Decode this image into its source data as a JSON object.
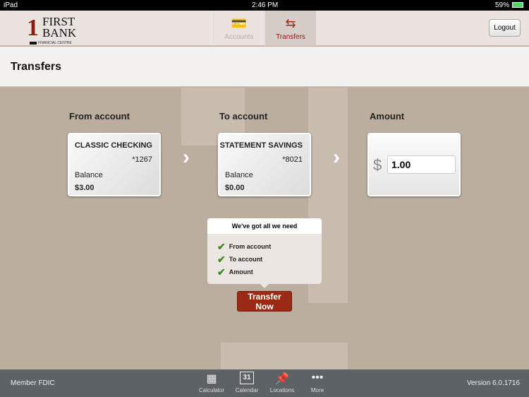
{
  "status": {
    "device": "iPad",
    "time": "2:46 PM",
    "battery": "59%"
  },
  "header": {
    "logo": {
      "one": "1",
      "line1": "FIRST",
      "line2": "BANK",
      "sub": "FINANCIAL CENTRE"
    },
    "tabs": [
      {
        "label": "Accounts",
        "icon": "credit-card-icon",
        "active": false
      },
      {
        "label": "Transfers",
        "icon": "transfer-arrows-icon",
        "active": true
      }
    ],
    "logout": "Logout"
  },
  "page": {
    "title": "Transfers"
  },
  "from": {
    "label": "From account",
    "name": "CLASSIC CHECKING",
    "number": "*1267",
    "balance_label": "Balance",
    "balance": "$3.00"
  },
  "to": {
    "label": "To account",
    "name": "STATEMENT SAVINGS",
    "number": "*8021",
    "balance_label": "Balance",
    "balance": "$0.00"
  },
  "amount": {
    "label": "Amount",
    "currency": "$",
    "value": "1.00"
  },
  "checklist": {
    "title": "We've got all we need",
    "items": [
      "From account",
      "To account",
      "Amount"
    ]
  },
  "transfer_button": "Transfer Now",
  "footer": {
    "left": "Member FDIC",
    "version": "Version 6.0.1716",
    "items": [
      {
        "label": "Calculator",
        "icon": "calculator-icon"
      },
      {
        "label": "Calendar",
        "icon": "calendar-icon",
        "day": "31"
      },
      {
        "label": "Locations",
        "icon": "pin-icon"
      },
      {
        "label": "More",
        "icon": "more-icon"
      }
    ]
  },
  "colors": {
    "accent": "#9b2a14",
    "check": "#3c8a1e"
  }
}
